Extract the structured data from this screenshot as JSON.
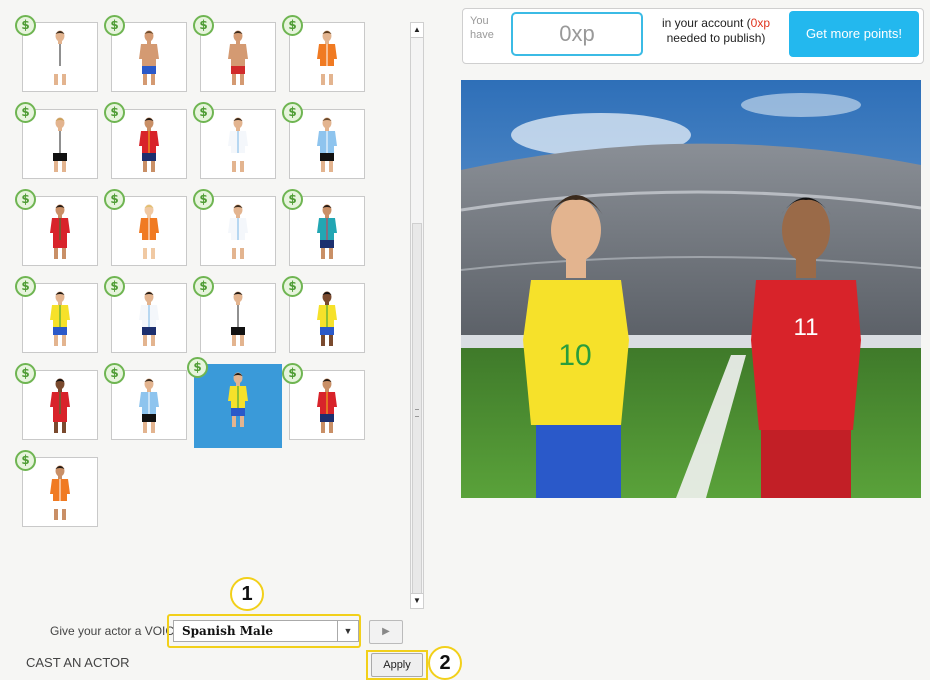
{
  "actor_grid": {
    "badge_symbol": "$",
    "actors": [
      {
        "name": "germany-white-kit",
        "skin": "#e3b48f",
        "hair": "#3a2a1c",
        "shirt": "#ffffff",
        "trim": "#222222",
        "shorts": "#ffffff",
        "selected": false
      },
      {
        "name": "shirtless-blue-shorts",
        "skin": "#d49a72",
        "hair": "#6b4a2c",
        "shirt": "#d49a72",
        "trim": "#d49a72",
        "shorts": "#2a59c9",
        "selected": false
      },
      {
        "name": "shirtless-red-shorts",
        "skin": "#d49a72",
        "hair": "#3a2a1c",
        "shirt": "#d49a72",
        "trim": "#d49a72",
        "shorts": "#d12a2a",
        "selected": false
      },
      {
        "name": "netherlands-orange-kit",
        "skin": "#e3b48f",
        "hair": "#5a3a1c",
        "shirt": "#f07a22",
        "trim": "#ffffff",
        "shorts": "#ffffff",
        "selected": false
      },
      {
        "name": "germany-white-kit-2",
        "skin": "#e3b48f",
        "hair": "#c9a05a",
        "shirt": "#ffffff",
        "trim": "#222222",
        "shorts": "#111111",
        "selected": false
      },
      {
        "name": "spain-red-kit",
        "skin": "#c98f66",
        "hair": "#221a14",
        "shirt": "#d8232a",
        "trim": "#f2c318",
        "shorts": "#1c2f6e",
        "selected": false
      },
      {
        "name": "argentina-white-kit",
        "skin": "#e3b48f",
        "hair": "#3a2a1c",
        "shirt": "#f4f7fb",
        "trim": "#7ab8e8",
        "shorts": "#ffffff",
        "selected": false
      },
      {
        "name": "argentina-striped-kit",
        "skin": "#e3b48f",
        "hair": "#6b4a2c",
        "shirt": "#8ec4ee",
        "trim": "#ffffff",
        "shorts": "#111111",
        "selected": false
      },
      {
        "name": "portugal-red-kit",
        "skin": "#c98f66",
        "hair": "#221a14",
        "shirt": "#d8232a",
        "trim": "#1f8a3c",
        "shorts": "#d8232a",
        "selected": false
      },
      {
        "name": "netherlands-orange-kit-2",
        "skin": "#f0c9a3",
        "hair": "#e0c070",
        "shirt": "#f07a22",
        "trim": "#ffffff",
        "shorts": "#ffffff",
        "selected": false
      },
      {
        "name": "argentina-white-kit-2",
        "skin": "#e3b48f",
        "hair": "#3a2a1c",
        "shirt": "#f4f7fb",
        "trim": "#7ab8e8",
        "shorts": "#ffffff",
        "selected": false
      },
      {
        "name": "teal-kit",
        "skin": "#c98f66",
        "hair": "#221a14",
        "shirt": "#22a6b3",
        "trim": "#e2334b",
        "shorts": "#1c2f6e",
        "selected": false
      },
      {
        "name": "brazil-yellow-kit",
        "skin": "#e3b48f",
        "hair": "#221a14",
        "shirt": "#f6e12a",
        "trim": "#2a9d3c",
        "shorts": "#2a59c9",
        "selected": false
      },
      {
        "name": "argentina-white-kit-3",
        "skin": "#e3b48f",
        "hair": "#221a14",
        "shirt": "#f4f7fb",
        "trim": "#7ab8e8",
        "shorts": "#1c2f6e",
        "selected": false
      },
      {
        "name": "germany-white-kit-3",
        "skin": "#e3b48f",
        "hair": "#221a14",
        "shirt": "#ffffff",
        "trim": "#222222",
        "shorts": "#111111",
        "selected": false
      },
      {
        "name": "brazil-yellow-kit-2",
        "skin": "#7a4a2e",
        "hair": "#111111",
        "shirt": "#f6e12a",
        "trim": "#2a9d3c",
        "shorts": "#2a59c9",
        "selected": false
      },
      {
        "name": "portugal-red-kit-2",
        "skin": "#7a4a2e",
        "hair": "#111111",
        "shirt": "#d8232a",
        "trim": "#1f8a3c",
        "shorts": "#d8232a",
        "selected": false
      },
      {
        "name": "argentina-striped-kit-2",
        "skin": "#e3b48f",
        "hair": "#3a2a1c",
        "shirt": "#8ec4ee",
        "trim": "#ffffff",
        "shorts": "#111111",
        "selected": false
      },
      {
        "name": "brazil-yellow-kit-selected",
        "skin": "#e3b48f",
        "hair": "#221a14",
        "shirt": "#f6e12a",
        "trim": "#2a9d3c",
        "shorts": "#2a59c9",
        "selected": true
      },
      {
        "name": "spain-red-kit-2",
        "skin": "#c98f66",
        "hair": "#221a14",
        "shirt": "#d8232a",
        "trim": "#f2c318",
        "shorts": "#1c2f6e",
        "selected": false
      },
      {
        "name": "netherlands-orange-kit-3",
        "skin": "#c98f66",
        "hair": "#221a14",
        "shirt": "#f07a22",
        "trim": "#ffffff",
        "shorts": "#ffffff",
        "selected": false
      }
    ]
  },
  "voice": {
    "label": "Give your actor a VOICE:",
    "selected": "Spanish Male",
    "play_icon": "play-triangle-icon"
  },
  "callouts": {
    "one": "1",
    "two": "2"
  },
  "cast": {
    "title": "CAST AN ACTOR",
    "apply_label": "Apply"
  },
  "points": {
    "you_have": "You have",
    "xp": "0xp",
    "text_before": "in your account (",
    "needed": "0xp",
    "text_after": "needed to publish)",
    "button": "Get more points!"
  },
  "preview": {
    "left_player": {
      "number": "10",
      "shirt": "#f6e12a",
      "shorts": "#2a59c9"
    },
    "right_player": {
      "number": "11",
      "shirt": "#d8232a",
      "shorts": "#d8232a"
    }
  },
  "colors": {
    "accent": "#23b8ee",
    "highlight": "#f2d01a",
    "selected_tile": "#3a9ad9",
    "needed_red": "#e0341e"
  }
}
